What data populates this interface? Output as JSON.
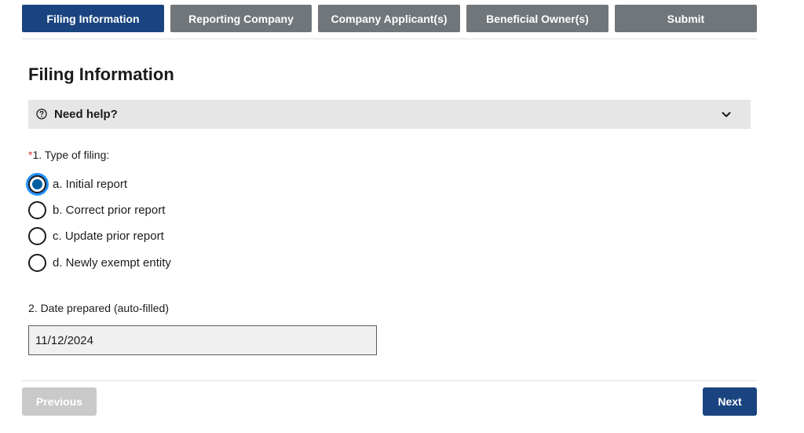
{
  "steps": [
    {
      "label": "Filing Information",
      "active": true
    },
    {
      "label": "Reporting Company",
      "active": false
    },
    {
      "label": "Company Applicant(s)",
      "active": false
    },
    {
      "label": "Beneficial Owner(s)",
      "active": false
    },
    {
      "label": "Submit",
      "active": false
    }
  ],
  "page_title": "Filing Information",
  "help": {
    "label": "Need help?",
    "icon": "question-circle-icon",
    "toggle_icon": "chevron-down-icon"
  },
  "question1": {
    "required_marker": "*",
    "label": "1. Type of filing:",
    "options": [
      {
        "label": "a. Initial report",
        "checked": true
      },
      {
        "label": "b. Correct prior report",
        "checked": false
      },
      {
        "label": "c. Update prior report",
        "checked": false
      },
      {
        "label": "d. Newly exempt entity",
        "checked": false
      }
    ]
  },
  "question2": {
    "label": "2. Date prepared (auto-filled)",
    "value": "11/12/2024"
  },
  "nav": {
    "previous_label": "Previous",
    "next_label": "Next"
  },
  "colors": {
    "active_step": "#1a4480",
    "inactive_step": "#71767a",
    "required": "#d83933",
    "radio_focus": "#2491ff",
    "disabled_button": "#c9c9c9"
  }
}
